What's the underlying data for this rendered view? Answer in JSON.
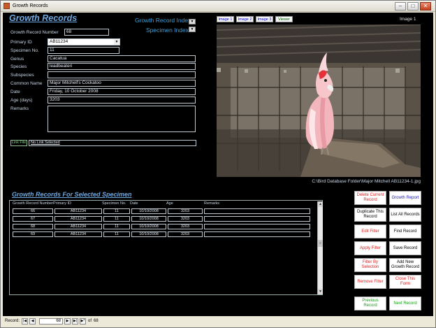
{
  "window": {
    "title": "Growth Records"
  },
  "form": {
    "title": "Growth Records",
    "growth_index_label": "Growth Record Index",
    "specimen_index_label": "Specimen Index",
    "fields": {
      "growth_record_number": {
        "label": "Growth Record Number",
        "value": "68"
      },
      "primary_id": {
        "label": "Primary ID",
        "value": "AB11234"
      },
      "specimen_no": {
        "label": "Specimen No.",
        "value": "11"
      },
      "genus": {
        "label": "Genus",
        "value": "Cacatua"
      },
      "species": {
        "label": "Species",
        "value": "leadbeateri"
      },
      "subspecies": {
        "label": "Subspecies",
        "value": ""
      },
      "common_name": {
        "label": "Common Name",
        "value": "Major Mitchell's Cockatoo"
      },
      "date": {
        "label": "Date",
        "value": "Friday, 10 October 2008"
      },
      "age_days": {
        "label": "Age (days)",
        "value": "3203"
      },
      "remarks": {
        "label": "Remarks",
        "value": ""
      }
    },
    "link_file_label": "Link File",
    "link_status": "No Link Selected"
  },
  "images": {
    "tabs": [
      "Image 1",
      "Image 2",
      "Image 3",
      "Viewer"
    ],
    "current_label": "Image 1",
    "file_path": "C:\\Bird Database Folder\\Major Mitchell AB11234-1.jpg"
  },
  "subform": {
    "title": "Growth Records For Selected Specimen",
    "columns": [
      "Growth Record Number",
      "Primary ID",
      "Specimen No.",
      "Date",
      "Age",
      "Remarks"
    ],
    "rows": [
      [
        "66",
        "AB11234",
        "11",
        "10/10/2008",
        "3203",
        ""
      ],
      [
        "67",
        "AB11234",
        "11",
        "10/10/2008",
        "3203",
        ""
      ],
      [
        "68",
        "AB11234",
        "11",
        "10/10/2008",
        "3203",
        ""
      ],
      [
        "69",
        "AB11234",
        "11",
        "10/10/2008",
        "3203",
        ""
      ]
    ]
  },
  "buttons": {
    "delete": "Delete Current Record",
    "growth_report": "Growth Report",
    "duplicate": "Duplicate This Record",
    "list_all": "List All Records",
    "edit_filter": "Edit Filter",
    "find": "Find Record",
    "apply_filter": "Apply Filter",
    "save": "Save Record",
    "filter_selection": "Filter By Selection",
    "add_new": "Add New Growth Record",
    "remove_filter": "Remove Filter",
    "close_form": "Close This Form",
    "previous": "Previous Record",
    "next": "Next Record"
  },
  "navigation": {
    "label": "Record:",
    "current": "68",
    "of_label": "of",
    "total": "68"
  },
  "colors": {
    "title_blue": "#6fa8e0",
    "index_blue": "#3fa0d8",
    "button_red": "#e02020",
    "button_green": "#10a010"
  }
}
